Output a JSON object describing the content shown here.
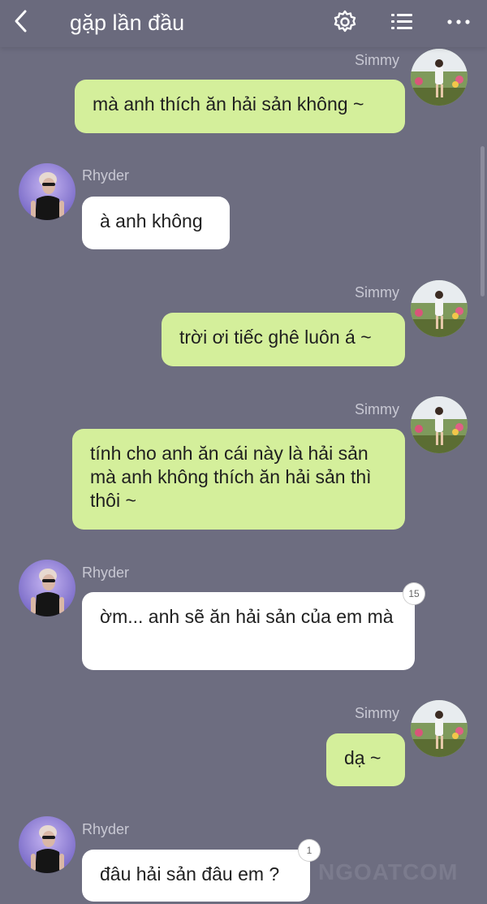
{
  "header": {
    "title": "gặp lần đầu",
    "back_icon": "back-arrow-icon",
    "settings_icon": "gear-icon",
    "menu_icon": "list-icon",
    "more_icon": "more-dots-icon"
  },
  "messages": [
    {
      "sender": "Simmy",
      "text": "mà anh thích ăn hải sản không ~",
      "direction": "out"
    },
    {
      "sender": "Rhyder",
      "text": "à anh không",
      "direction": "in"
    },
    {
      "sender": "Simmy",
      "text": "trời ơi tiếc ghê luôn á ~",
      "direction": "out"
    },
    {
      "sender": "Simmy",
      "text": "tính cho anh ăn cái này là hải sản mà anh không thích ăn hải sản thì thôi ~",
      "direction": "out"
    },
    {
      "sender": "Rhyder",
      "text": "ờm... anh sẽ ăn hải sản của em mà",
      "direction": "in",
      "reaction_count": "15"
    },
    {
      "sender": "Simmy",
      "text": "dạ ~",
      "direction": "out"
    },
    {
      "sender": "Rhyder",
      "text": "đâu hải sản đâu em ?",
      "direction": "in",
      "reaction_count": "1"
    }
  ],
  "watermark": "NGOATCOM",
  "colors": {
    "background": "#6d6d80",
    "outgoing_bubble": "#d4ef9b",
    "incoming_bubble": "#ffffff",
    "sender_name": "#c8c8d3"
  }
}
